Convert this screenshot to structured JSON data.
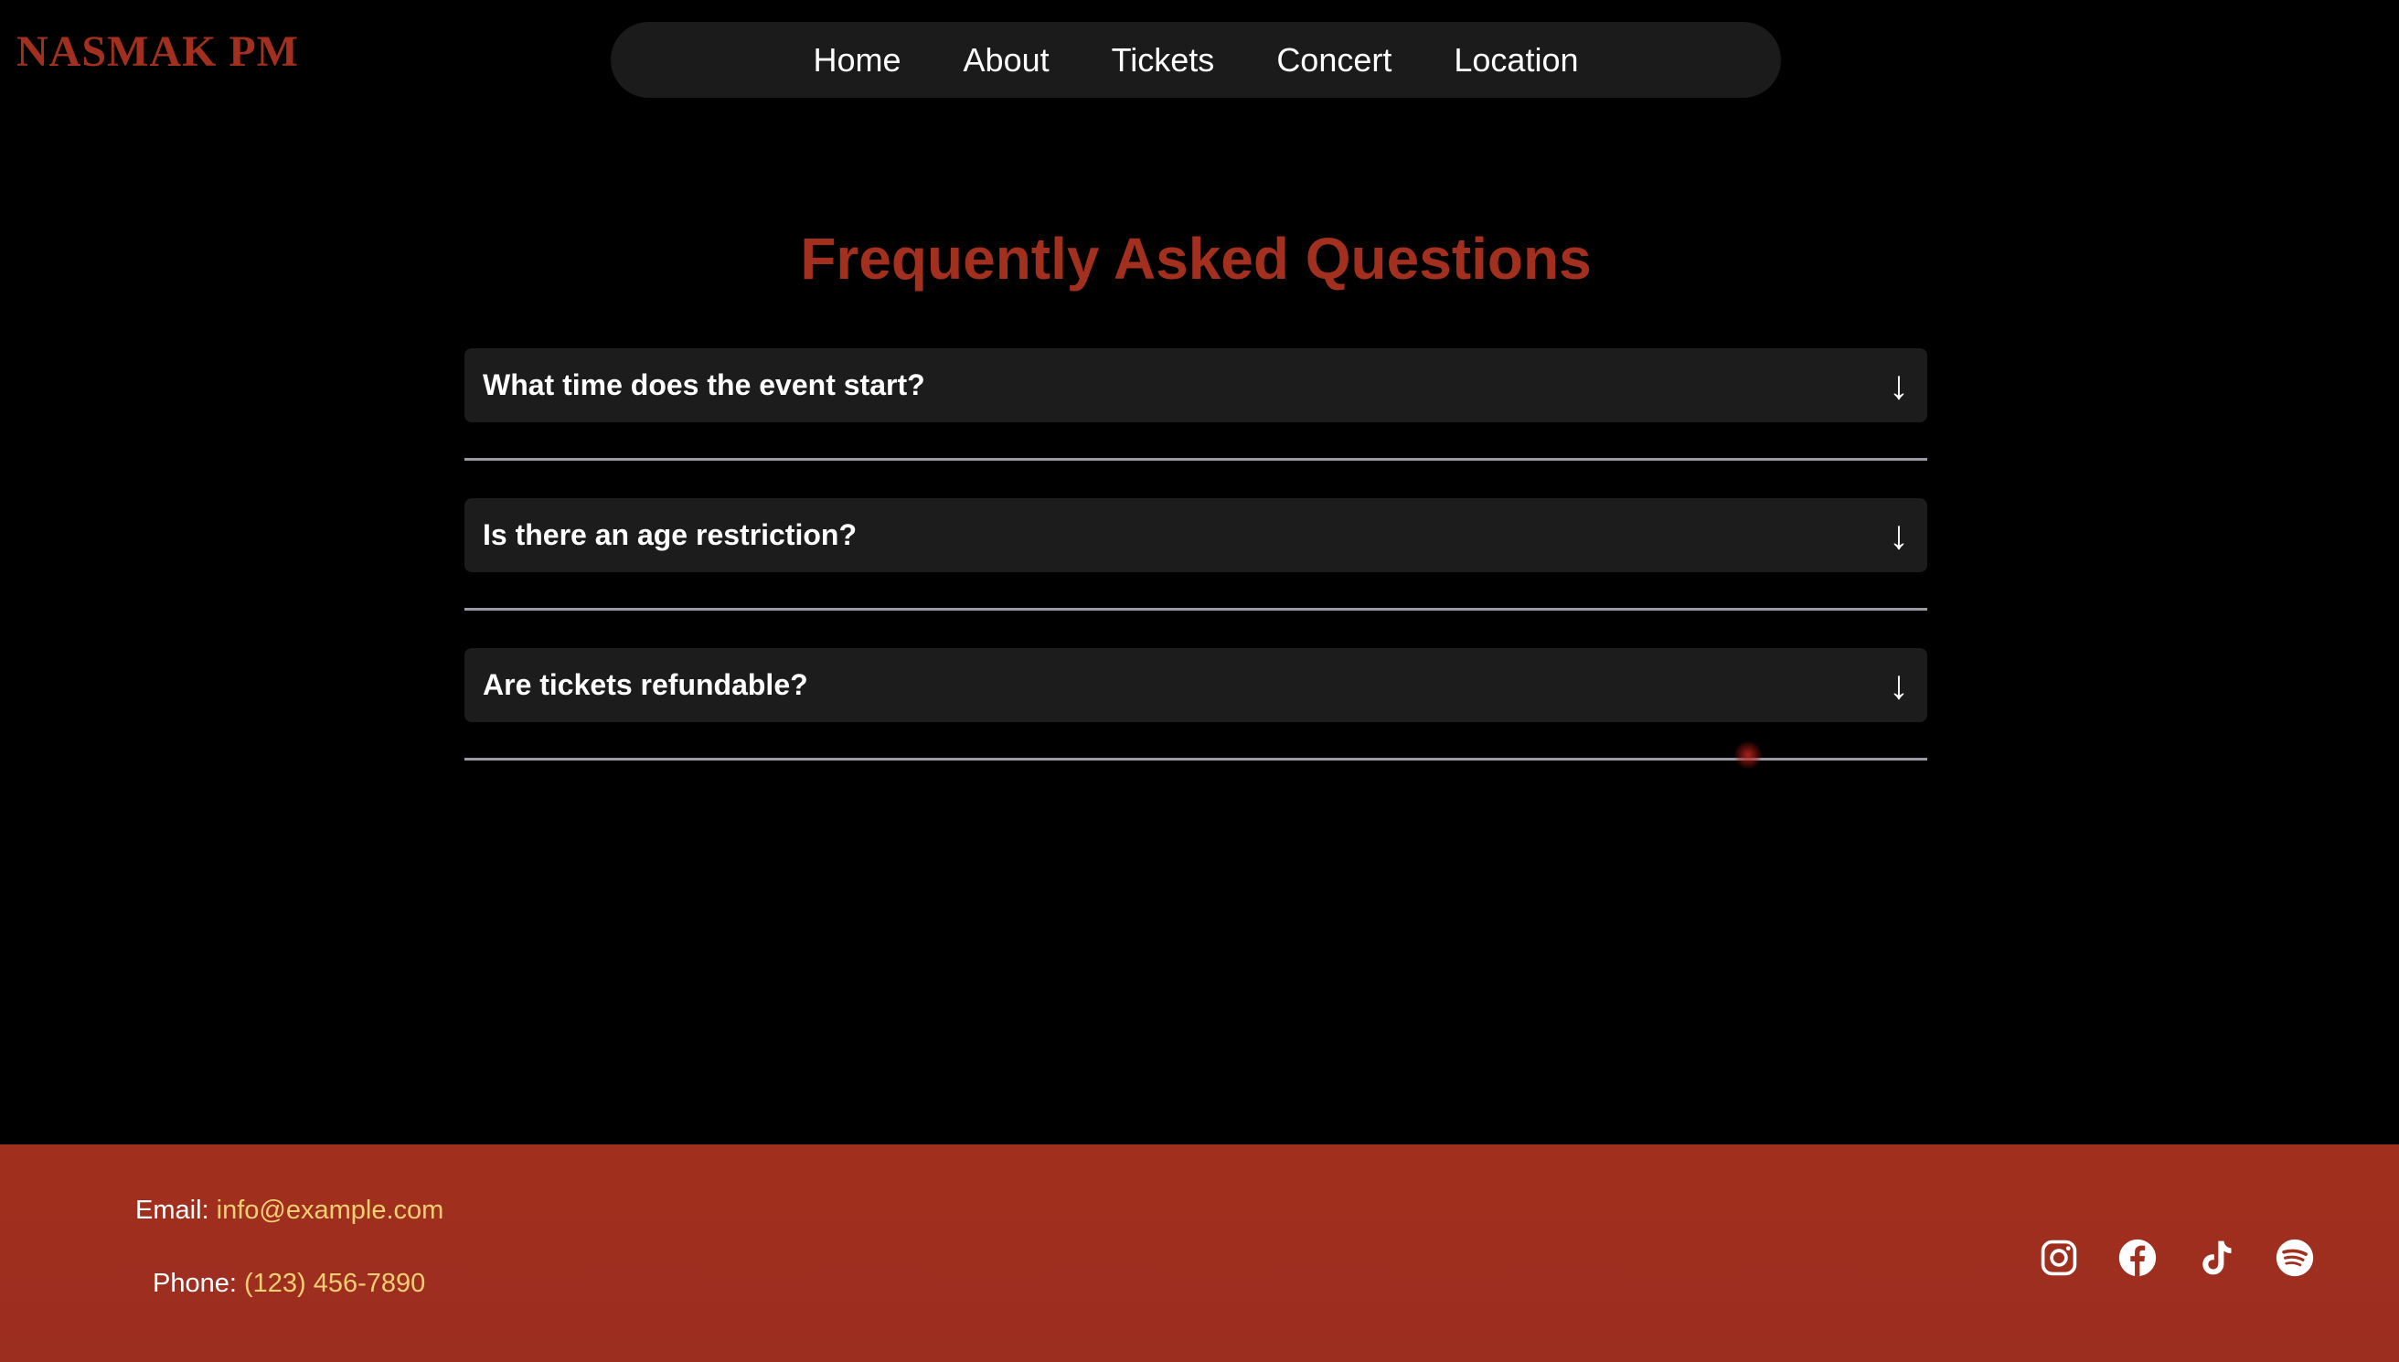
{
  "brand": {
    "logo_text": "NASMAK PM",
    "accent_color": "#a3301e"
  },
  "nav": {
    "items": [
      {
        "label": "Home"
      },
      {
        "label": "About"
      },
      {
        "label": "Tickets"
      },
      {
        "label": "Concert"
      },
      {
        "label": "Location"
      }
    ]
  },
  "faq": {
    "title": "Frequently Asked Questions",
    "items": [
      {
        "question": "What time does the event start?",
        "arrow": "↓"
      },
      {
        "question": "Is there an age restriction?",
        "arrow": "↓"
      },
      {
        "question": "Are tickets refundable?",
        "arrow": "↓"
      }
    ]
  },
  "footer": {
    "email_label": "Email:",
    "email_value": "info@example.com",
    "phone_label": "Phone:",
    "phone_value": "(123) 456-7890",
    "link_color": "#f4cf72",
    "background_color": "#a12f1e",
    "socials": [
      {
        "icon": "instagram-icon"
      },
      {
        "icon": "facebook-icon"
      },
      {
        "icon": "tiktok-icon"
      },
      {
        "icon": "spotify-icon"
      }
    ]
  }
}
